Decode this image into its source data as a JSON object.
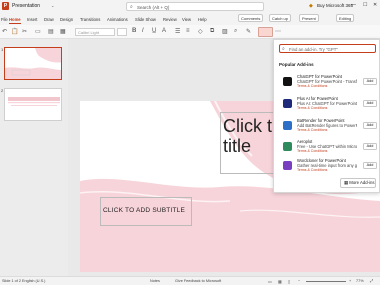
{
  "titlebar": {
    "app_logo": "P",
    "filename": "Presentation",
    "search_placeholder": "Search (Alt + Q)",
    "buy_label": "Buy Microsoft 365",
    "window_controls": [
      "—",
      "☐",
      "✕"
    ]
  },
  "ribbon": {
    "tabs": [
      "File",
      "Home",
      "Insert",
      "Draw",
      "Design",
      "Transitions",
      "Animations",
      "Slide Show",
      "Review",
      "View",
      "Help"
    ],
    "active_tab": "Home",
    "buttons": {
      "comments": "Comments",
      "catch_up": "Catch up",
      "present": "Present",
      "editing": "Editing"
    }
  },
  "toolbar": {
    "font_name": "Calibri Light",
    "font_size": ""
  },
  "thumbnails": {
    "numbers": [
      "1",
      "2"
    ]
  },
  "slide": {
    "title_placeholder": "Click to add title",
    "title_visible": "Click t\ntitle",
    "subtitle_placeholder": "CLICK TO ADD SUBTITLE"
  },
  "addins_pane": {
    "search_placeholder": "Find an add-in. Try \"GPT\"",
    "heading": "Popular Add-ins",
    "items": [
      {
        "name": "ChatGPT for PowerPoint",
        "desc": "ChatGPT for PowerPoint - Transform...",
        "terms": "Terms & Conditions",
        "add": "Add",
        "color": "#111111",
        "icon": "chatgpt-icon"
      },
      {
        "name": "Plus AI for PowerPoint",
        "desc": "Plus AI: ChatGPT for PowerPoint. Cr...",
        "terms": "Terms & Conditions",
        "add": "Add",
        "color": "#1f2a7a",
        "icon": "plus-ai-icon"
      },
      {
        "name": "BatRender for PowerPoint",
        "desc": "Add BatRender figures to PowerPoint",
        "terms": "Terms & Conditions",
        "add": "Add",
        "color": "#2d6ec7",
        "icon": "batrender-icon"
      },
      {
        "name": "Aeroplot",
        "desc": "Free - Use ChatGPT within Microsoft...",
        "terms": "Terms & Conditions",
        "add": "Add",
        "color": "#2f8a5c",
        "icon": "aeroplot-icon"
      },
      {
        "name": "Wordcloner for PowerPoint",
        "desc": "Gather real-time input from any group",
        "terms": "Terms & Conditions",
        "add": "Add",
        "color": "#7a3fc0",
        "icon": "wordcloner-icon"
      }
    ],
    "more_label": "More Add-ins"
  },
  "statusbar": {
    "slide_info": "Slide 1 of 2",
    "language": "English (U.S.)",
    "notes": "Notes",
    "feedback": "Give Feedback to Microsoft",
    "zoom": "77%"
  },
  "colors": {
    "accent": "#c43e1c",
    "design_pink": "#f7d4da"
  }
}
